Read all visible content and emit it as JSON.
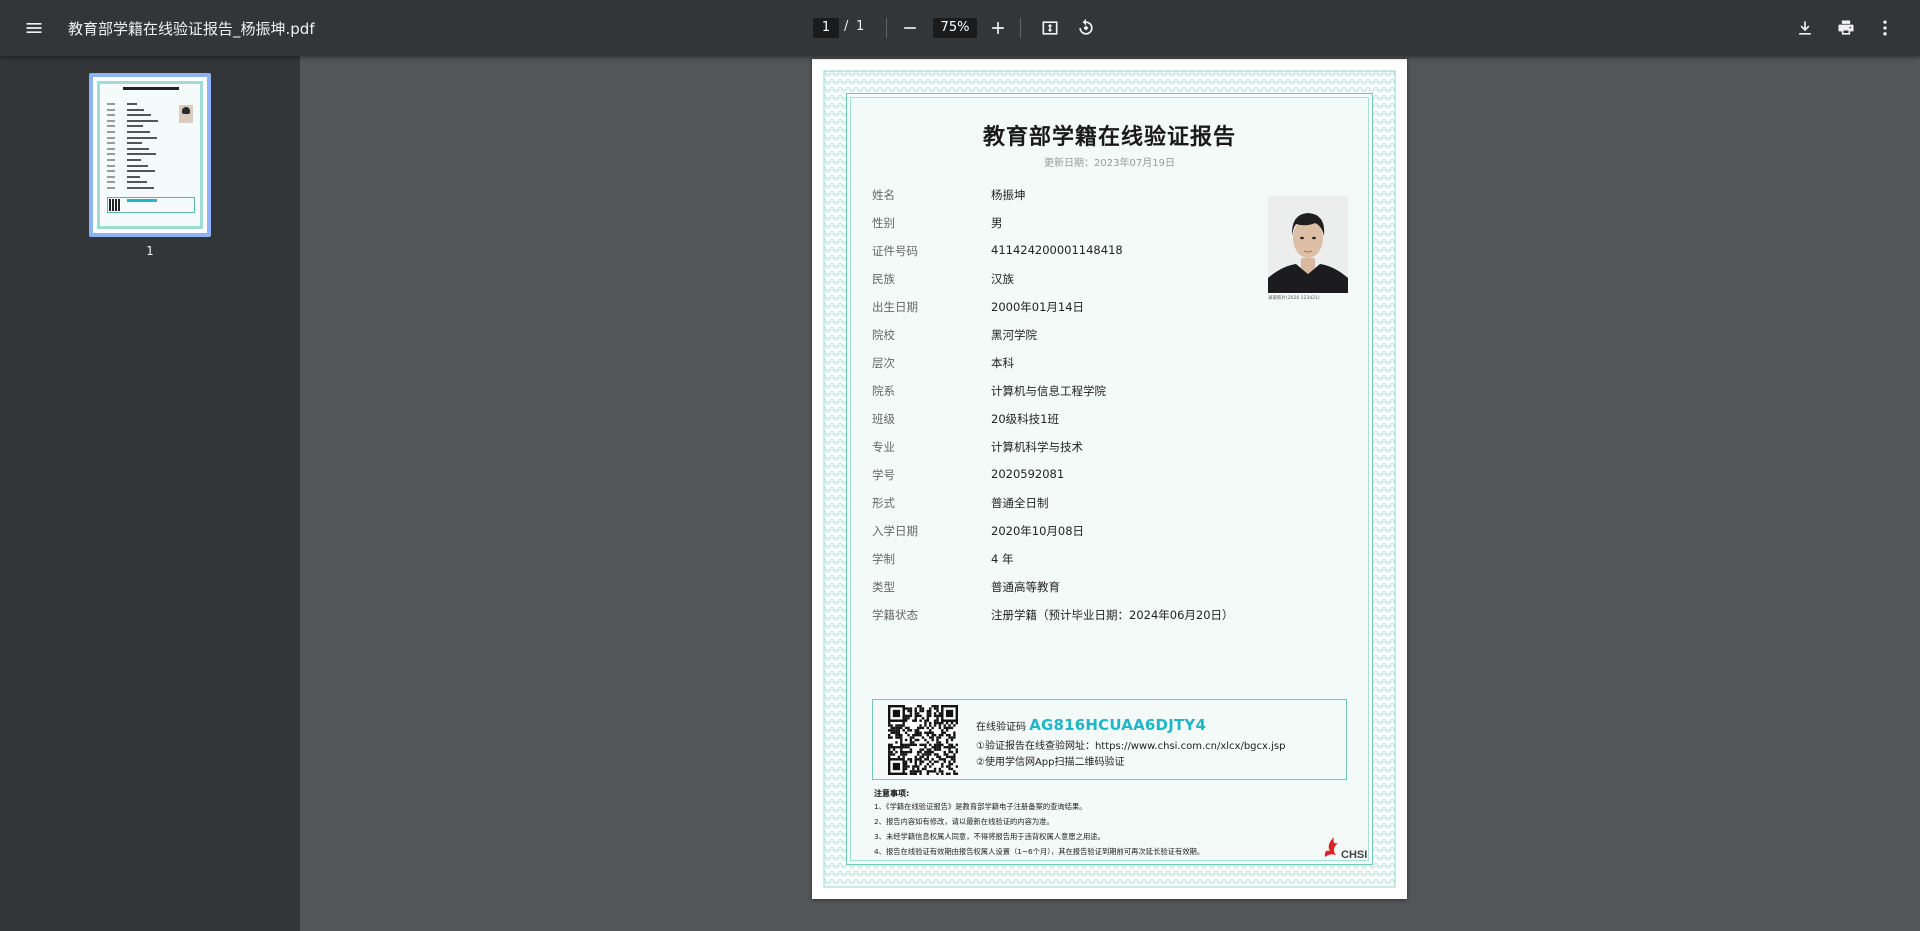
{
  "toolbar": {
    "title": "教育部学籍在线验证报告_杨振坤.pdf",
    "page_current": "1",
    "page_separator": "/",
    "page_total": "1",
    "zoom": "75%"
  },
  "sidebar": {
    "thumbnail_label": "1"
  },
  "report": {
    "title": "教育部学籍在线验证报告",
    "update_date": "更新日期：2023年07月19日",
    "fields": [
      {
        "label": "姓名",
        "value": "杨振坤"
      },
      {
        "label": "性别",
        "value": "男"
      },
      {
        "label": "证件号码",
        "value": "411424200001148418"
      },
      {
        "label": "民族",
        "value": "汉族"
      },
      {
        "label": "出生日期",
        "value": "2000年01月14日"
      },
      {
        "label": "院校",
        "value": "黑河学院"
      },
      {
        "label": "层次",
        "value": "本科"
      },
      {
        "label": "院系",
        "value": "计算机与信息工程学院"
      },
      {
        "label": "班级",
        "value": "20级科技1班"
      },
      {
        "label": "专业",
        "value": "计算机科学与技术"
      },
      {
        "label": "学号",
        "value": "2020592081"
      },
      {
        "label": "形式",
        "value": "普通全日制"
      },
      {
        "label": "入学日期",
        "value": "2020年10月08日"
      },
      {
        "label": "学制",
        "value": "4 年"
      },
      {
        "label": "类型",
        "value": "普通高等教育"
      },
      {
        "label": "学籍状态",
        "value": "注册学籍（预计毕业日期：2024年06月20日）"
      }
    ],
    "photo_caption": "录取照片(2020   123421)  ",
    "verification": {
      "code_label": "在线验证码",
      "code": "AG816HCUAA6DJTY4",
      "line1": "①验证报告在线查验网址：https://www.chsi.com.cn/xlcx/bgcx.jsp",
      "line2": "②使用学信网App扫描二维码验证"
    },
    "notes_title": "注意事项:",
    "notes": [
      "1、《学籍在线验证报告》是教育部学籍电子注册备案的查询结果。",
      "2、报告内容如有修改，请以最新在线验证的内容为准。",
      "3、未经学籍信息权属人同意，不得将报告用于违背权属人意愿之用途。",
      "4、报告在线验证有效期由报告权属人设置（1~6个月），其在报告验证到期前可再次延长验证有效期。"
    ],
    "logo_text": "CHSI"
  },
  "colors": {
    "toolbar_bg": "#323639",
    "viewer_bg": "#525659",
    "frame_teal": "#6fc8b8",
    "code_cyan": "#1fb6c7",
    "thumb_highlight": "#8ab4f8"
  },
  "icons": [
    "menu-icon",
    "zoom-out-icon",
    "zoom-in-icon",
    "fit-page-icon",
    "rotate-icon",
    "download-icon",
    "print-icon",
    "more-vert-icon"
  ]
}
